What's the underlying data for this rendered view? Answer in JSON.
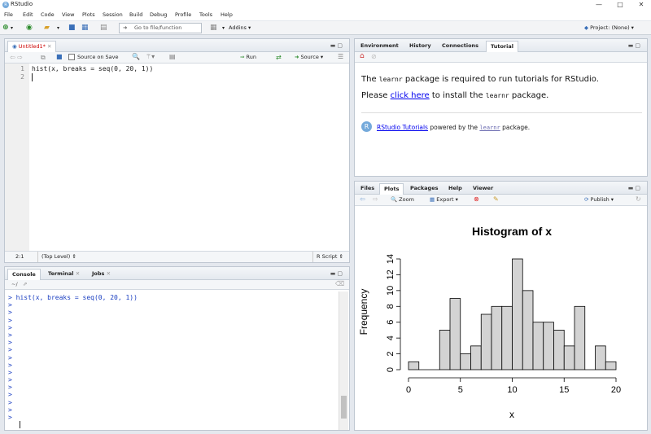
{
  "window": {
    "title": "RStudio",
    "min": "—",
    "max": "□",
    "close": "✕"
  },
  "menu": [
    "File",
    "Edit",
    "Code",
    "View",
    "Plots",
    "Session",
    "Build",
    "Debug",
    "Profile",
    "Tools",
    "Help"
  ],
  "toolbar": {
    "goto_placeholder": "Go to file/function",
    "addins": "Addins",
    "project": "Project: (None)"
  },
  "editor": {
    "tab": "Untitled1*",
    "source_on_save": "Source on Save",
    "run": "Run",
    "source": "Source",
    "lines": [
      {
        "n": "1",
        "code": "hist(x, breaks = seq(0, 20, 1))"
      },
      {
        "n": "2",
        "code": ""
      }
    ],
    "status": {
      "pos": "2:1",
      "scope": "(Top Level)",
      "type": "R Script"
    }
  },
  "console": {
    "tabs": [
      "Console",
      "Terminal",
      "Jobs"
    ],
    "path": "~/",
    "lines": [
      "> hist(x, breaks = seq(0, 20, 1))",
      ">",
      ">",
      ">",
      ">",
      ">",
      ">",
      ">",
      ">",
      ">",
      ">",
      ">",
      ">",
      ">",
      ">",
      ">",
      ">"
    ]
  },
  "env": {
    "tabs": [
      "Environment",
      "History",
      "Connections",
      "Tutorial"
    ],
    "tutorial": {
      "p1_a": "The ",
      "p1_pkg": "learnr",
      "p1_b": " package is required to run tutorials for RStudio.",
      "p2_a": "Please ",
      "p2_link": "click here",
      "p2_b": " to install the ",
      "p2_pkg": "learnr",
      "p2_c": " package.",
      "foot_link": "RStudio Tutorials",
      "foot_a": " powered by the ",
      "foot_pkg": "learnr",
      "foot_b": " package."
    }
  },
  "files": {
    "tabs": [
      "Files",
      "Plots",
      "Packages",
      "Help",
      "Viewer"
    ],
    "zoom": "Zoom",
    "export": "Export",
    "publish": "Publish"
  },
  "chart_data": {
    "type": "bar",
    "title": "Histogram of x",
    "xlabel": "x",
    "ylabel": "Frequency",
    "bin_edges": [
      0,
      1,
      2,
      3,
      4,
      5,
      6,
      7,
      8,
      9,
      10,
      11,
      12,
      13,
      14,
      15,
      16,
      17,
      18,
      19,
      20
    ],
    "values": [
      1,
      0,
      0,
      5,
      9,
      2,
      3,
      7,
      8,
      8,
      14,
      10,
      6,
      6,
      5,
      3,
      8,
      0,
      3,
      1
    ],
    "xticks": [
      "0",
      "5",
      "10",
      "15",
      "20"
    ],
    "yticks": [
      "0",
      "2",
      "4",
      "6",
      "8",
      "10",
      "12",
      "14"
    ],
    "xlim": [
      0,
      20
    ],
    "ylim": [
      0,
      14
    ],
    "bar_color": "#d3d3d3"
  }
}
